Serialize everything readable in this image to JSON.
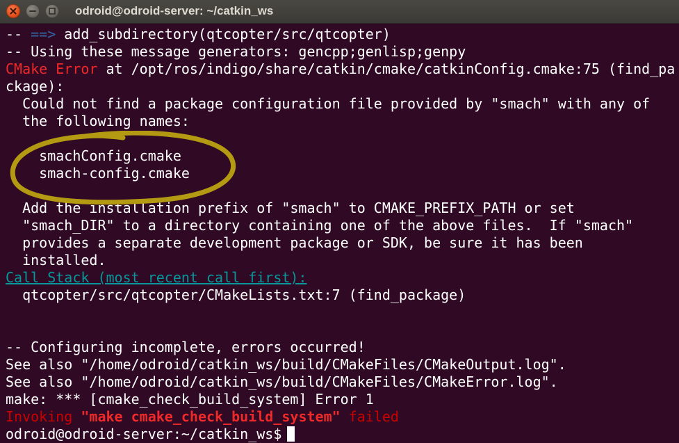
{
  "window": {
    "title": "odroid@odroid-server: ~/catkin_ws"
  },
  "icons": {
    "close": "close-icon",
    "minimize": "minimize-icon",
    "maximize": "maximize-icon"
  },
  "colors": {
    "background": "#300a24",
    "text": "#ffffff",
    "error_red": "#ef2929",
    "arrow_blue": "#3465a4",
    "callstack_teal": "#06989a",
    "highlight_ellipse": "#b39a12"
  },
  "terminal": {
    "l01_prefix": "-- ",
    "l01_arrow": "==>",
    "l01_rest": " add_subdirectory(qtcopter/src/qtcopter)",
    "l02": "-- Using these message generators: gencpp;genlisp;genpy",
    "l03_error": "CMake Error",
    "l03_rest": " at /opt/ros/indigo/share/catkin/cmake/catkinConfig.cmake:75 (find_pa",
    "l04": "ckage):",
    "l05": "  Could not find a package configuration file provided by \"smach\" with any of",
    "l06": "  the following names:",
    "l07": "",
    "l08": "    smachConfig.cmake",
    "l09": "    smach-config.cmake",
    "l10": "",
    "l11": "  Add the installation prefix of \"smach\" to CMAKE_PREFIX_PATH or set",
    "l12": "  \"smach_DIR\" to a directory containing one of the above files.  If \"smach\"",
    "l13": "  provides a separate development package or SDK, be sure it has been",
    "l14": "  installed.",
    "l15": "Call Stack (most recent call first):",
    "l16": "  qtcopter/src/qtcopter/CMakeLists.txt:7 (find_package)",
    "l17": "",
    "l18": "",
    "l19": "-- Configuring incomplete, errors occurred!",
    "l20": "See also \"/home/odroid/catkin_ws/build/CMakeFiles/CMakeOutput.log\".",
    "l21": "See also \"/home/odroid/catkin_ws/build/CMakeFiles/CMakeError.log\".",
    "l22": "make: *** [cmake_check_build_system] Error 1",
    "l23_a": "Invoking ",
    "l23_b": "\"make cmake_check_build_system\"",
    "l23_c": " failed",
    "prompt": "odroid@odroid-server:~/catkin_ws$"
  }
}
